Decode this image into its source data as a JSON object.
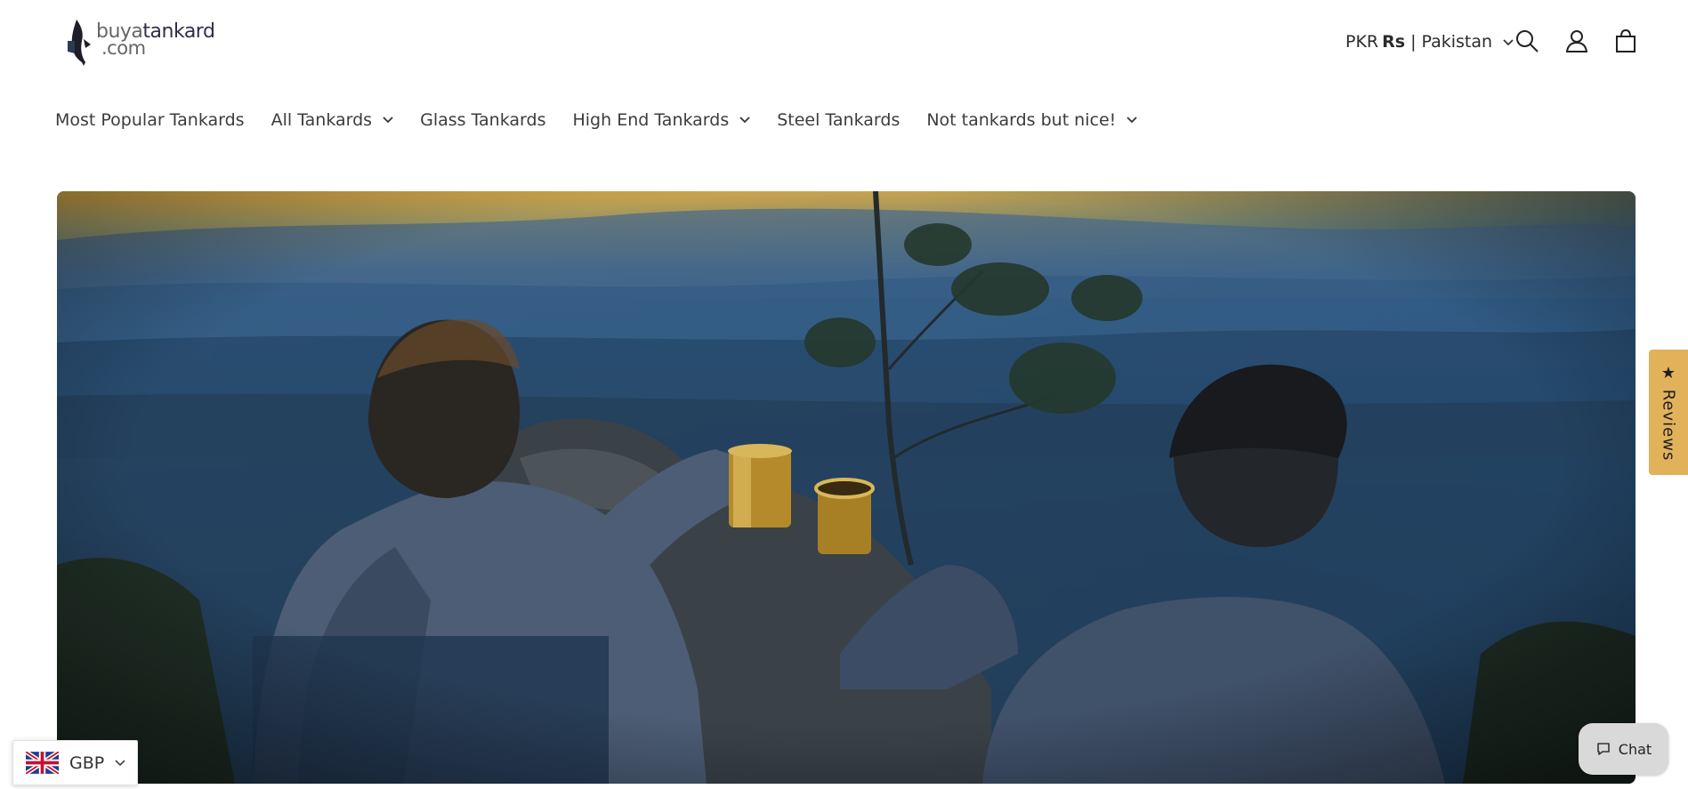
{
  "header": {
    "logo": {
      "line1_plain": "buya",
      "line1_bold": "tankard",
      "line2": ".com"
    },
    "currency_selector": {
      "code": "PKR",
      "symbol": "Rs",
      "separator": "|",
      "country": "Pakistan"
    }
  },
  "nav": {
    "items": [
      {
        "label": "Most Popular Tankards",
        "has_dropdown": false
      },
      {
        "label": "All Tankards",
        "has_dropdown": true
      },
      {
        "label": "Glass Tankards",
        "has_dropdown": false
      },
      {
        "label": "High End Tankards",
        "has_dropdown": true
      },
      {
        "label": "Steel Tankards",
        "has_dropdown": false
      },
      {
        "label": "Not tankards but nice!",
        "has_dropdown": true
      }
    ]
  },
  "icons": [
    "search-icon",
    "account-icon",
    "cart-icon",
    "chevron-down-icon",
    "chat-bubble-icon",
    "star-icon",
    "uk-flag-icon"
  ],
  "reviews_tab": {
    "label": "★ Reviews",
    "color": "#e1b25a"
  },
  "chat_button": {
    "label": "Chat"
  },
  "currency_widget": {
    "code": "GBP"
  },
  "colors": {
    "nav_text": "#3c3c3c",
    "reviews_tab": "#e1b25a",
    "chat_bg": "#d9d9d9"
  }
}
